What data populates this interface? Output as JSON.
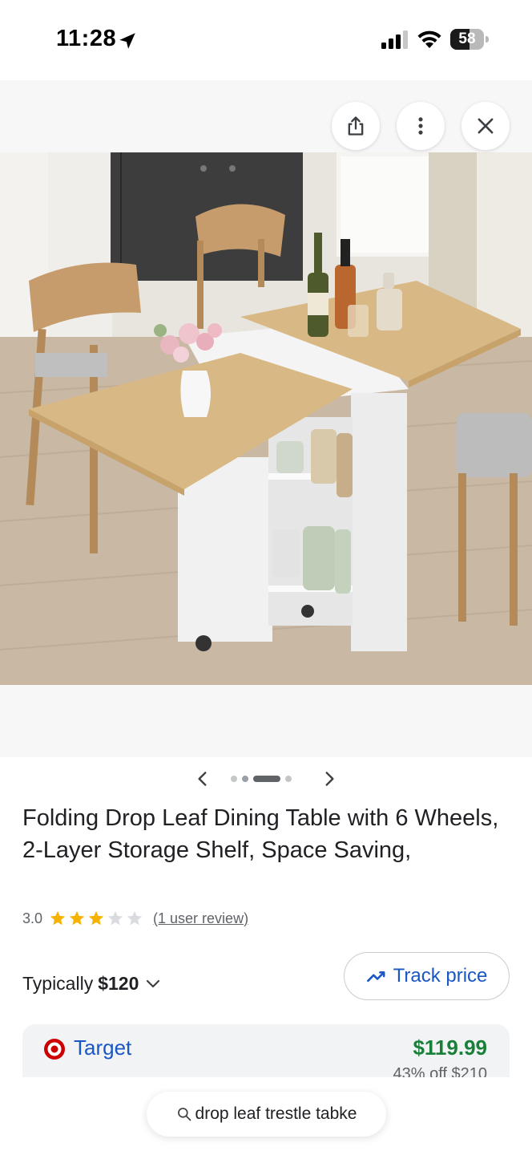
{
  "status_bar": {
    "time": "11:28",
    "battery": "58",
    "battery_level": 0.58
  },
  "image_viewer": {
    "share_icon": "share-icon",
    "more_icon": "more-vertical-icon",
    "close_icon": "close-icon",
    "carousel": {
      "dot_count": 4,
      "active_index": 2
    }
  },
  "product": {
    "title": "Folding Drop Leaf Dining Table with 6 Wheels, 2-Layer Storage Shelf, Space Saving,",
    "rating_value": "3.0",
    "stars_filled": 3,
    "stars_total": 5,
    "reviews_link": "(1 user review)",
    "typically_label": "Typically",
    "typical_price": "$120",
    "track_price_label": "Track price"
  },
  "store": {
    "name": "Target",
    "price": "$119.99",
    "discount_note": "43% off $210"
  },
  "search": {
    "query": "drop leaf trestle tabke"
  },
  "colors": {
    "link_blue": "#1a57c4",
    "price_green": "#188038",
    "star_gold": "#f6b400",
    "target_red": "#cc0000"
  }
}
